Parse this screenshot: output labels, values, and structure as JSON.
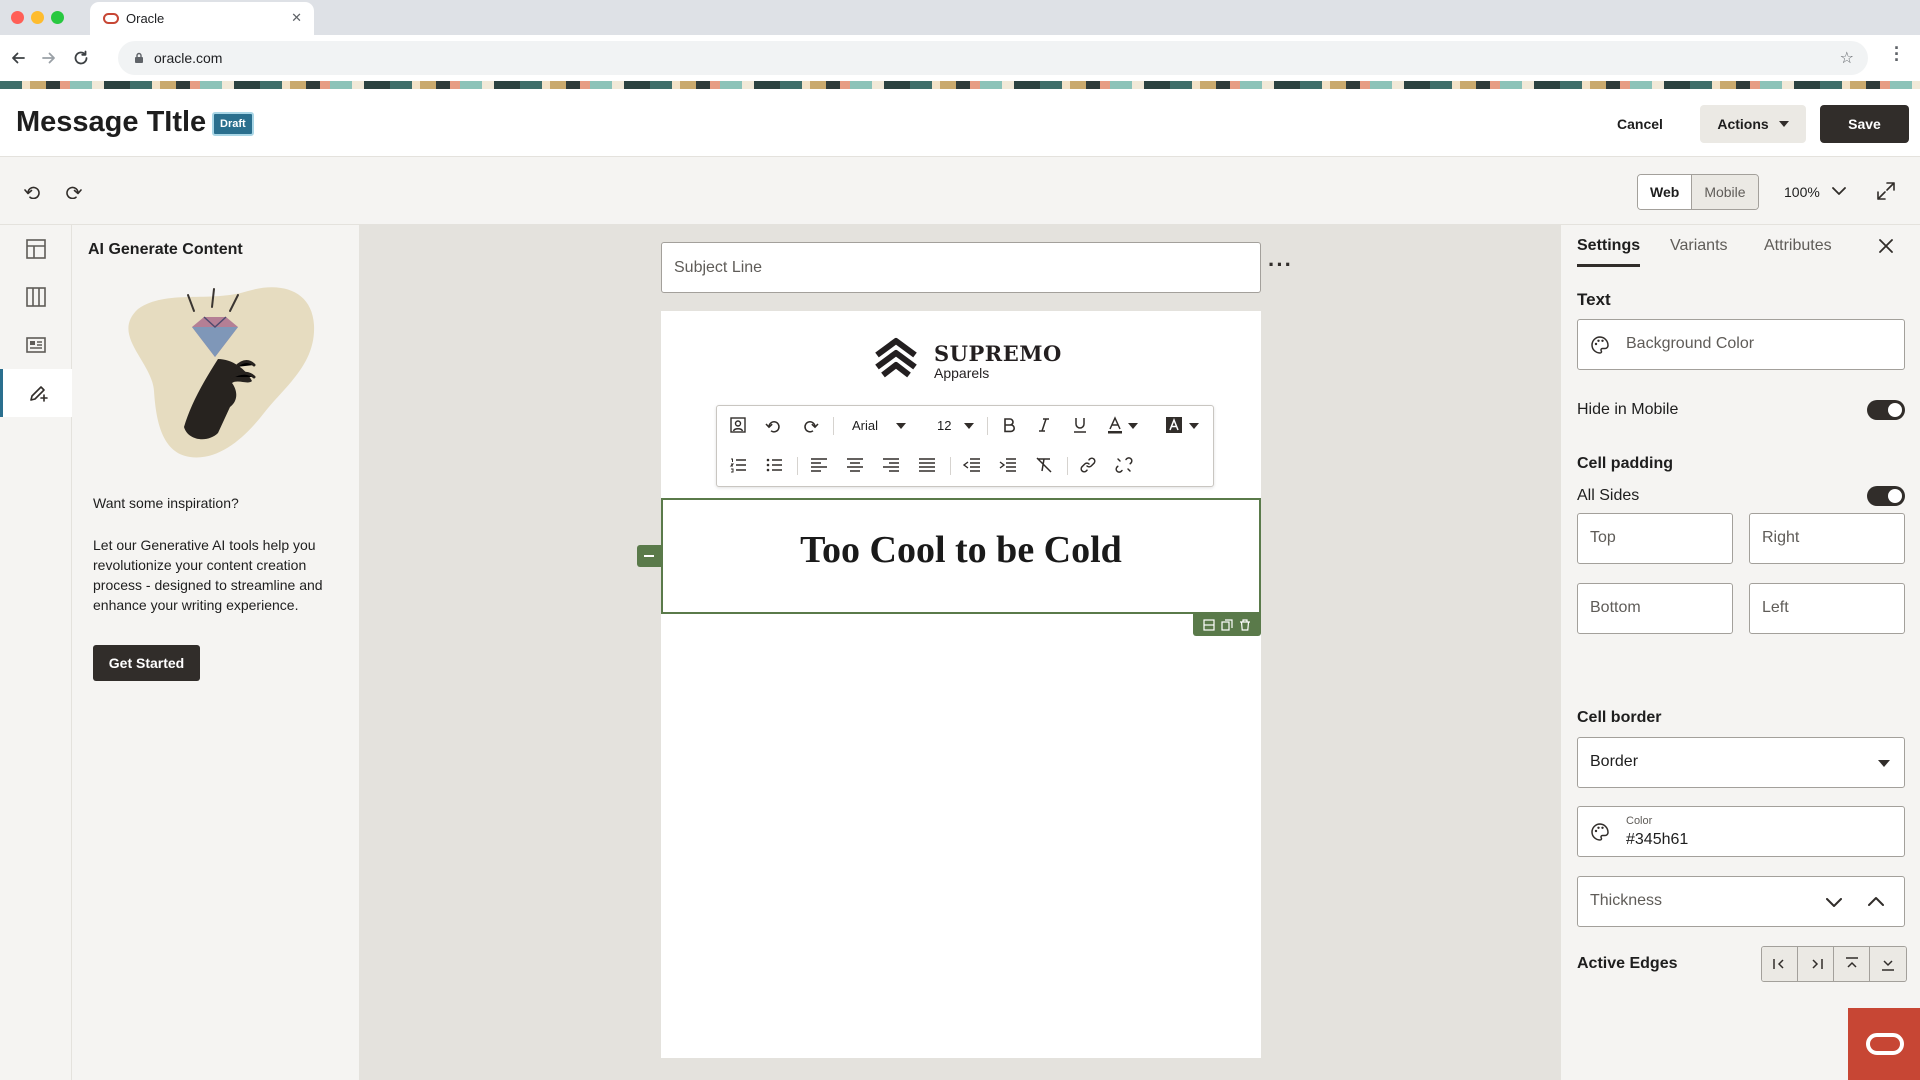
{
  "browser": {
    "tab_title": "Oracle",
    "url": "oracle.com"
  },
  "header": {
    "title": "Message TItle",
    "badge": "Draft",
    "cancel_label": "Cancel",
    "actions_label": "Actions",
    "save_label": "Save"
  },
  "toolbar": {
    "view_web": "Web",
    "view_mobile": "Mobile",
    "zoom": "100%"
  },
  "ai_panel": {
    "title": "AI Generate Content",
    "question": "Want some inspiration?",
    "body": "Let our Generative AI tools help you revolutionize your content creation process - designed to streamline and enhance your writing experience.",
    "cta": "Get Started"
  },
  "canvas": {
    "subject_placeholder": "Subject Line",
    "logo_name": "SUPREMO",
    "logo_sub": "Apparels",
    "headline": "Too Cool to be Cold",
    "rte": {
      "font": "Arial",
      "size": "12"
    }
  },
  "settings_panel": {
    "tabs": [
      "Settings",
      "Variants",
      "Attributes"
    ],
    "text_section": "Text",
    "background_color": "Background Color",
    "hide_mobile": "Hide in Mobile",
    "cell_padding": "Cell padding",
    "all_sides": "All Sides",
    "padding": {
      "top": "Top",
      "right": "Right",
      "bottom": "Bottom",
      "left": "Left"
    },
    "cell_border": "Cell border",
    "border_select": "Border",
    "color_label": "Color",
    "color_value": "#345h61",
    "thickness": "Thickness",
    "active_edges": "Active Edges"
  },
  "colors": {
    "primary_dark": "#312d2a",
    "accent_teal": "#2a6f8e",
    "selection_green": "#5a7a4a",
    "oracle_red": "#c74634"
  }
}
